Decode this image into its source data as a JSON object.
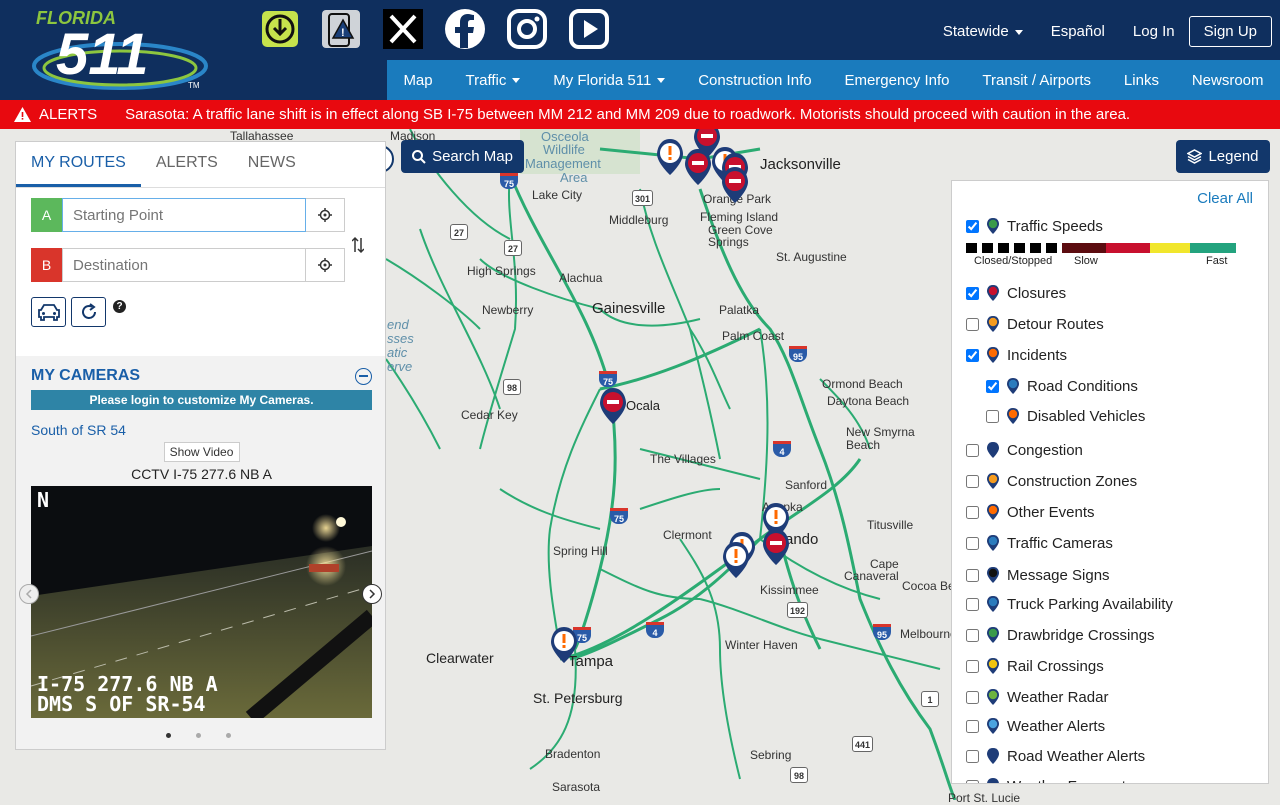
{
  "header": {
    "logo_text": "FLORIDA",
    "logo_number": "511",
    "logo_tm": "TM",
    "social_icons": [
      "download-app-icon",
      "report-icon",
      "x-icon",
      "facebook-icon",
      "instagram-icon",
      "youtube-icon"
    ],
    "top_nav": {
      "statewide": "Statewide",
      "espanol": "Español",
      "login": "Log In",
      "signup": "Sign Up"
    },
    "main_nav": [
      "Map",
      "Traffic",
      "My Florida 511",
      "Construction Info",
      "Emergency Info",
      "Transit / Airports",
      "Links",
      "Newsroom"
    ]
  },
  "alert": {
    "label": "ALERTS",
    "message": "Sarasota: A traffic lane shift is in effect along SB I-75 between MM 212 and MM 209 due to roadwork. Motorists should proceed with caution in the area."
  },
  "left_panel": {
    "tabs": [
      "MY ROUTES",
      "ALERTS",
      "NEWS"
    ],
    "route_a": {
      "letter": "A",
      "placeholder": "Starting Point"
    },
    "route_b": {
      "letter": "B",
      "placeholder": "Destination"
    },
    "help": "?",
    "cameras": {
      "title": "MY CAMERAS",
      "login_msg": "Please login to customize My Cameras.",
      "camera_link": "South of SR 54",
      "show_video": "Show Video",
      "camera_title": "CCTV I-75 277.6 NB A",
      "overlay_line1": "I-75 277.6 NB A",
      "overlay_line2": "DMS S OF SR-54",
      "compass": "N"
    }
  },
  "map": {
    "search_label": "Search Map",
    "legend_label": "Legend",
    "labels": {
      "jacksonville": "Jacksonville",
      "gainesville": "Gainesville",
      "ocala": "Ocala",
      "orlando": "Orlando",
      "tampa": "Tampa",
      "st_pete": "St. Petersburg",
      "clearwater": "Clearwater",
      "the_villages": "The Villages",
      "palatka": "Palatka",
      "palm_coast": "Palm Coast",
      "st_augustine": "St. Augustine",
      "ormond": "Ormond Beach",
      "daytona": "Daytona Beach",
      "nsb1": "New Smyrna",
      "nsb2": "Beach",
      "sanford": "Sanford",
      "titusville": "Titusville",
      "kissimmee": "Kissimmee",
      "winter_haven": "Winter Haven",
      "sebring": "Sebring",
      "bradenton": "Bradenton",
      "sarasota": "Sarasota",
      "spring_hill": "Spring Hill",
      "clermont": "Clermont",
      "cedar_key": "Cedar Key",
      "newberry": "Newberry",
      "high_springs": "High Springs",
      "alachua": "Alachua",
      "lake_city": "Lake City",
      "middleburg": "Middleburg",
      "fleming1": "Fleming Island",
      "green1": "Green Cove",
      "green2": "Springs",
      "orange_park": "Orange Park",
      "madison": "Madison",
      "osceola1": "Osceola",
      "osceola2": "Wildlife",
      "osceola3": "Management",
      "osceola4": "Area",
      "cape1": "Cape",
      "cape2": "Canaveral",
      "cocoa": "Cocoa Be",
      "melbourne": "Melbourne",
      "apopka": "Apopka",
      "port_st_lucie": "Port St. Lucie",
      "end1": "end",
      "end2": "sses",
      "end3": "atic",
      "end4": "erve",
      "tallahassee": "Tallahassee",
      "hw75a": "75",
      "hw75b": "75",
      "hw75c": "75",
      "hw75d": "75",
      "hw95a": "95",
      "hw95b": "95",
      "hw4a": "4",
      "hw4b": "4",
      "hw301": "301",
      "hw27a": "27",
      "hw27b": "27",
      "hw98a": "98",
      "hw98b": "98",
      "hw192": "192",
      "hw441": "441",
      "hw1": "1"
    }
  },
  "legend": {
    "clear_all": "Clear All",
    "speed_closed": "Closed/Stopped",
    "speed_slow": "Slow",
    "speed_fast": "Fast",
    "items": [
      {
        "label": "Traffic Speeds",
        "checked": true
      },
      {
        "label": "Closures",
        "checked": true
      },
      {
        "label": "Detour Routes",
        "checked": false
      },
      {
        "label": "Incidents",
        "checked": true
      },
      {
        "label": "Road Conditions",
        "checked": true
      },
      {
        "label": "Disabled Vehicles",
        "checked": false
      },
      {
        "label": "Congestion",
        "checked": false
      },
      {
        "label": "Construction Zones",
        "checked": false
      },
      {
        "label": "Other Events",
        "checked": false
      },
      {
        "label": "Traffic Cameras",
        "checked": false
      },
      {
        "label": "Message Signs",
        "checked": false
      },
      {
        "label": "Truck Parking Availability",
        "checked": false
      },
      {
        "label": "Drawbridge Crossings",
        "checked": false
      },
      {
        "label": "Rail Crossings",
        "checked": false
      },
      {
        "label": "Weather Radar",
        "checked": false
      },
      {
        "label": "Weather Alerts",
        "checked": false
      },
      {
        "label": "Road Weather Alerts",
        "checked": false
      },
      {
        "label": "Weather Forecast",
        "checked": false
      }
    ]
  },
  "colors": {
    "header": "#0f2f5e",
    "nav": "#1a7bbd",
    "alert": "#e8090f",
    "road": "#2bab72",
    "closure": "#c8102e",
    "incident": "#ffffff"
  }
}
